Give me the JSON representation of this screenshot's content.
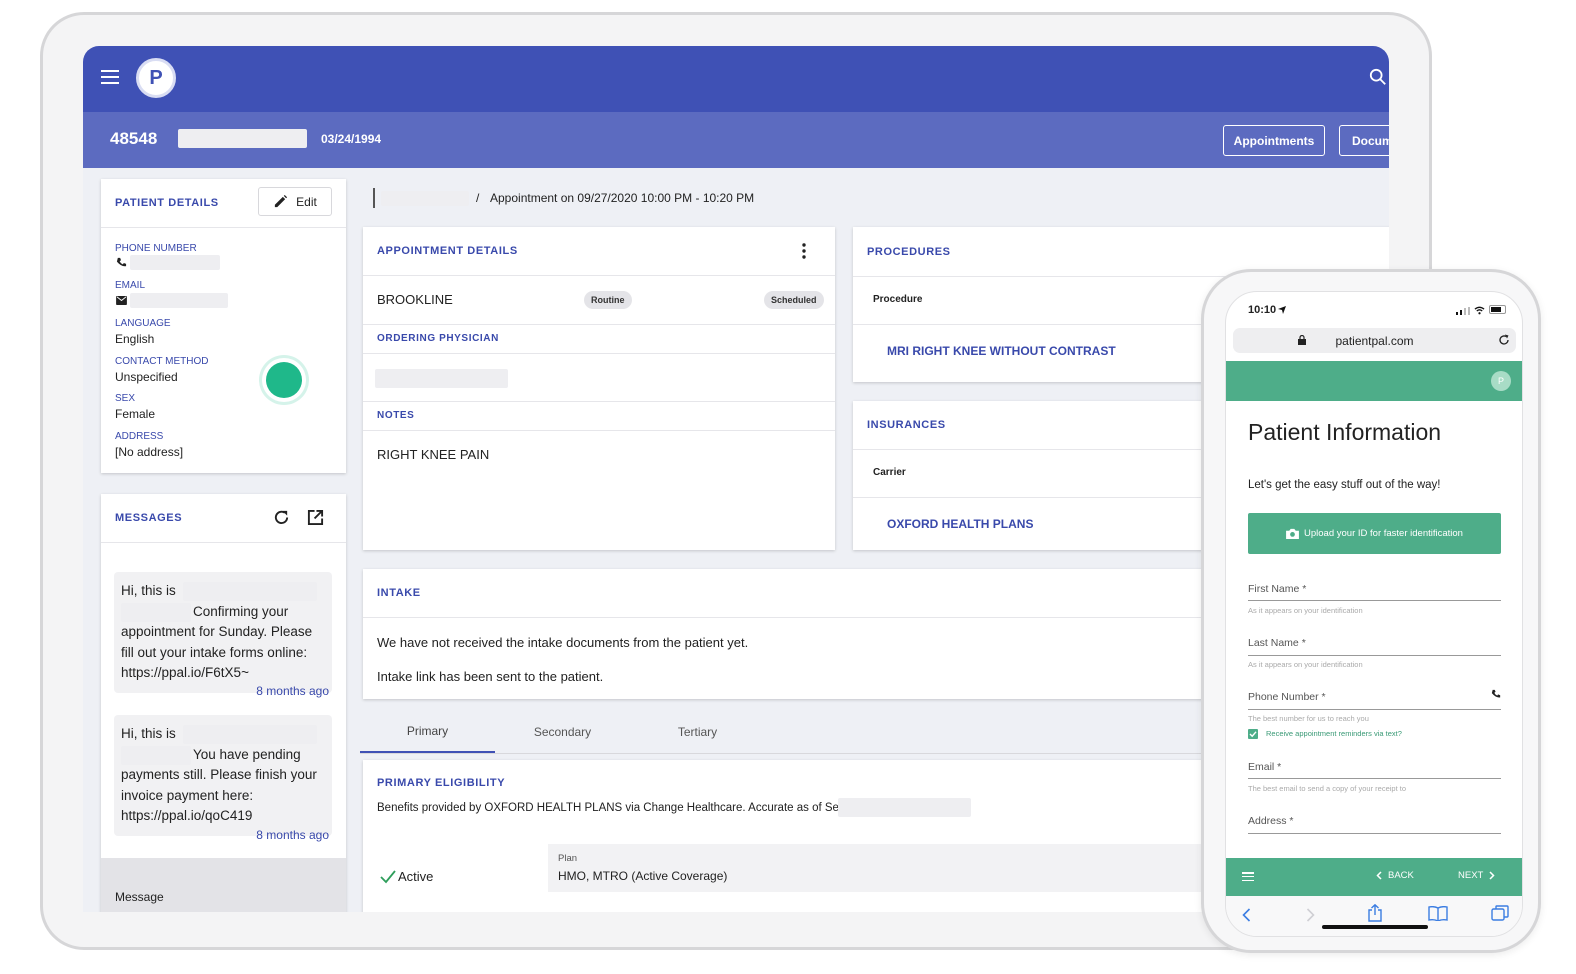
{
  "header": {
    "logo_letter": "P",
    "patient_id": "48548",
    "dob": "03/24/1994",
    "appointments_button": "Appointments",
    "documents_button": "Docum"
  },
  "patient_details": {
    "title": "PATIENT DETAILS",
    "edit_label": "Edit",
    "phone_label": "PHONE NUMBER",
    "email_label": "EMAIL",
    "language_label": "LANGUAGE",
    "language": "English",
    "contact_label": "CONTACT METHOD",
    "contact": "Unspecified",
    "sex_label": "SEX",
    "sex": "Female",
    "address_label": "ADDRESS",
    "address": "[No address]"
  },
  "messages": {
    "title": "MESSAGES",
    "items": [
      {
        "line1": "Hi, this is",
        "line2": "Confirming your",
        "rest": "appointment for Sunday. Please fill out your intake forms online: https://ppal.io/F6tX5~",
        "time": "8 months ago"
      },
      {
        "line1": "Hi, this is",
        "line2": "You have pending",
        "rest": "payments still. Please finish your invoice payment here: https://ppal.io/qoC419",
        "time": "8 months ago"
      }
    ],
    "input_placeholder": "Message"
  },
  "breadcrumb": {
    "separator": "/",
    "current": "Appointment on 09/27/2020 10:00 PM - 10:20 PM"
  },
  "appointment": {
    "title": "APPOINTMENT DETAILS",
    "location": "BROOKLINE",
    "type_chip": "Routine",
    "status_chip": "Scheduled",
    "physician_label": "ORDERING PHYSICIAN",
    "notes_label": "NOTES",
    "notes": "RIGHT KNEE PAIN"
  },
  "procedures": {
    "title": "PROCEDURES",
    "column": "Procedure",
    "item": "MRI RIGHT KNEE WITHOUT CONTRAST"
  },
  "insurances": {
    "title": "INSURANCES",
    "column": "Carrier",
    "item": "OXFORD HEALTH PLANS"
  },
  "intake": {
    "title": "INTAKE",
    "line1": "We have not received the intake documents from the patient yet.",
    "line2": "Intake link has been sent to the patient."
  },
  "tabs": [
    "Primary",
    "Secondary",
    "Tertiary"
  ],
  "eligibility": {
    "title": "PRIMARY ELIGIBILITY",
    "text": "Benefits provided by OXFORD HEALTH PLANS via Change Healthcare. Accurate as of Se",
    "status": "Active",
    "plan_label": "Plan",
    "plan": "HMO, MTRO (Active Coverage)"
  },
  "phone": {
    "time": "10:10",
    "url": "patientpal.com",
    "avatar_letter": "P",
    "title": "Patient Information",
    "subtitle": "Let's get the easy stuff out of the way!",
    "upload_button": "Upload your ID for faster identification",
    "fields": [
      {
        "label": "First Name *",
        "hint": "As it appears on your identification"
      },
      {
        "label": "Last Name *",
        "hint": "As it appears on your identification"
      },
      {
        "label": "Phone Number *",
        "hint": "The best number for us to reach you"
      },
      {
        "label": "Email *",
        "hint": "The best email to send a copy of your receipt to"
      },
      {
        "label": "Address *",
        "hint": ""
      }
    ],
    "reminder_checkbox": "Receive appointment reminders via text?",
    "back": "BACK",
    "next": "NEXT"
  },
  "colors": {
    "primary": "#3f51b5",
    "primary_light": "#5c6bc0",
    "accent_green": "#4ead89",
    "status_green": "#1fb88a"
  }
}
